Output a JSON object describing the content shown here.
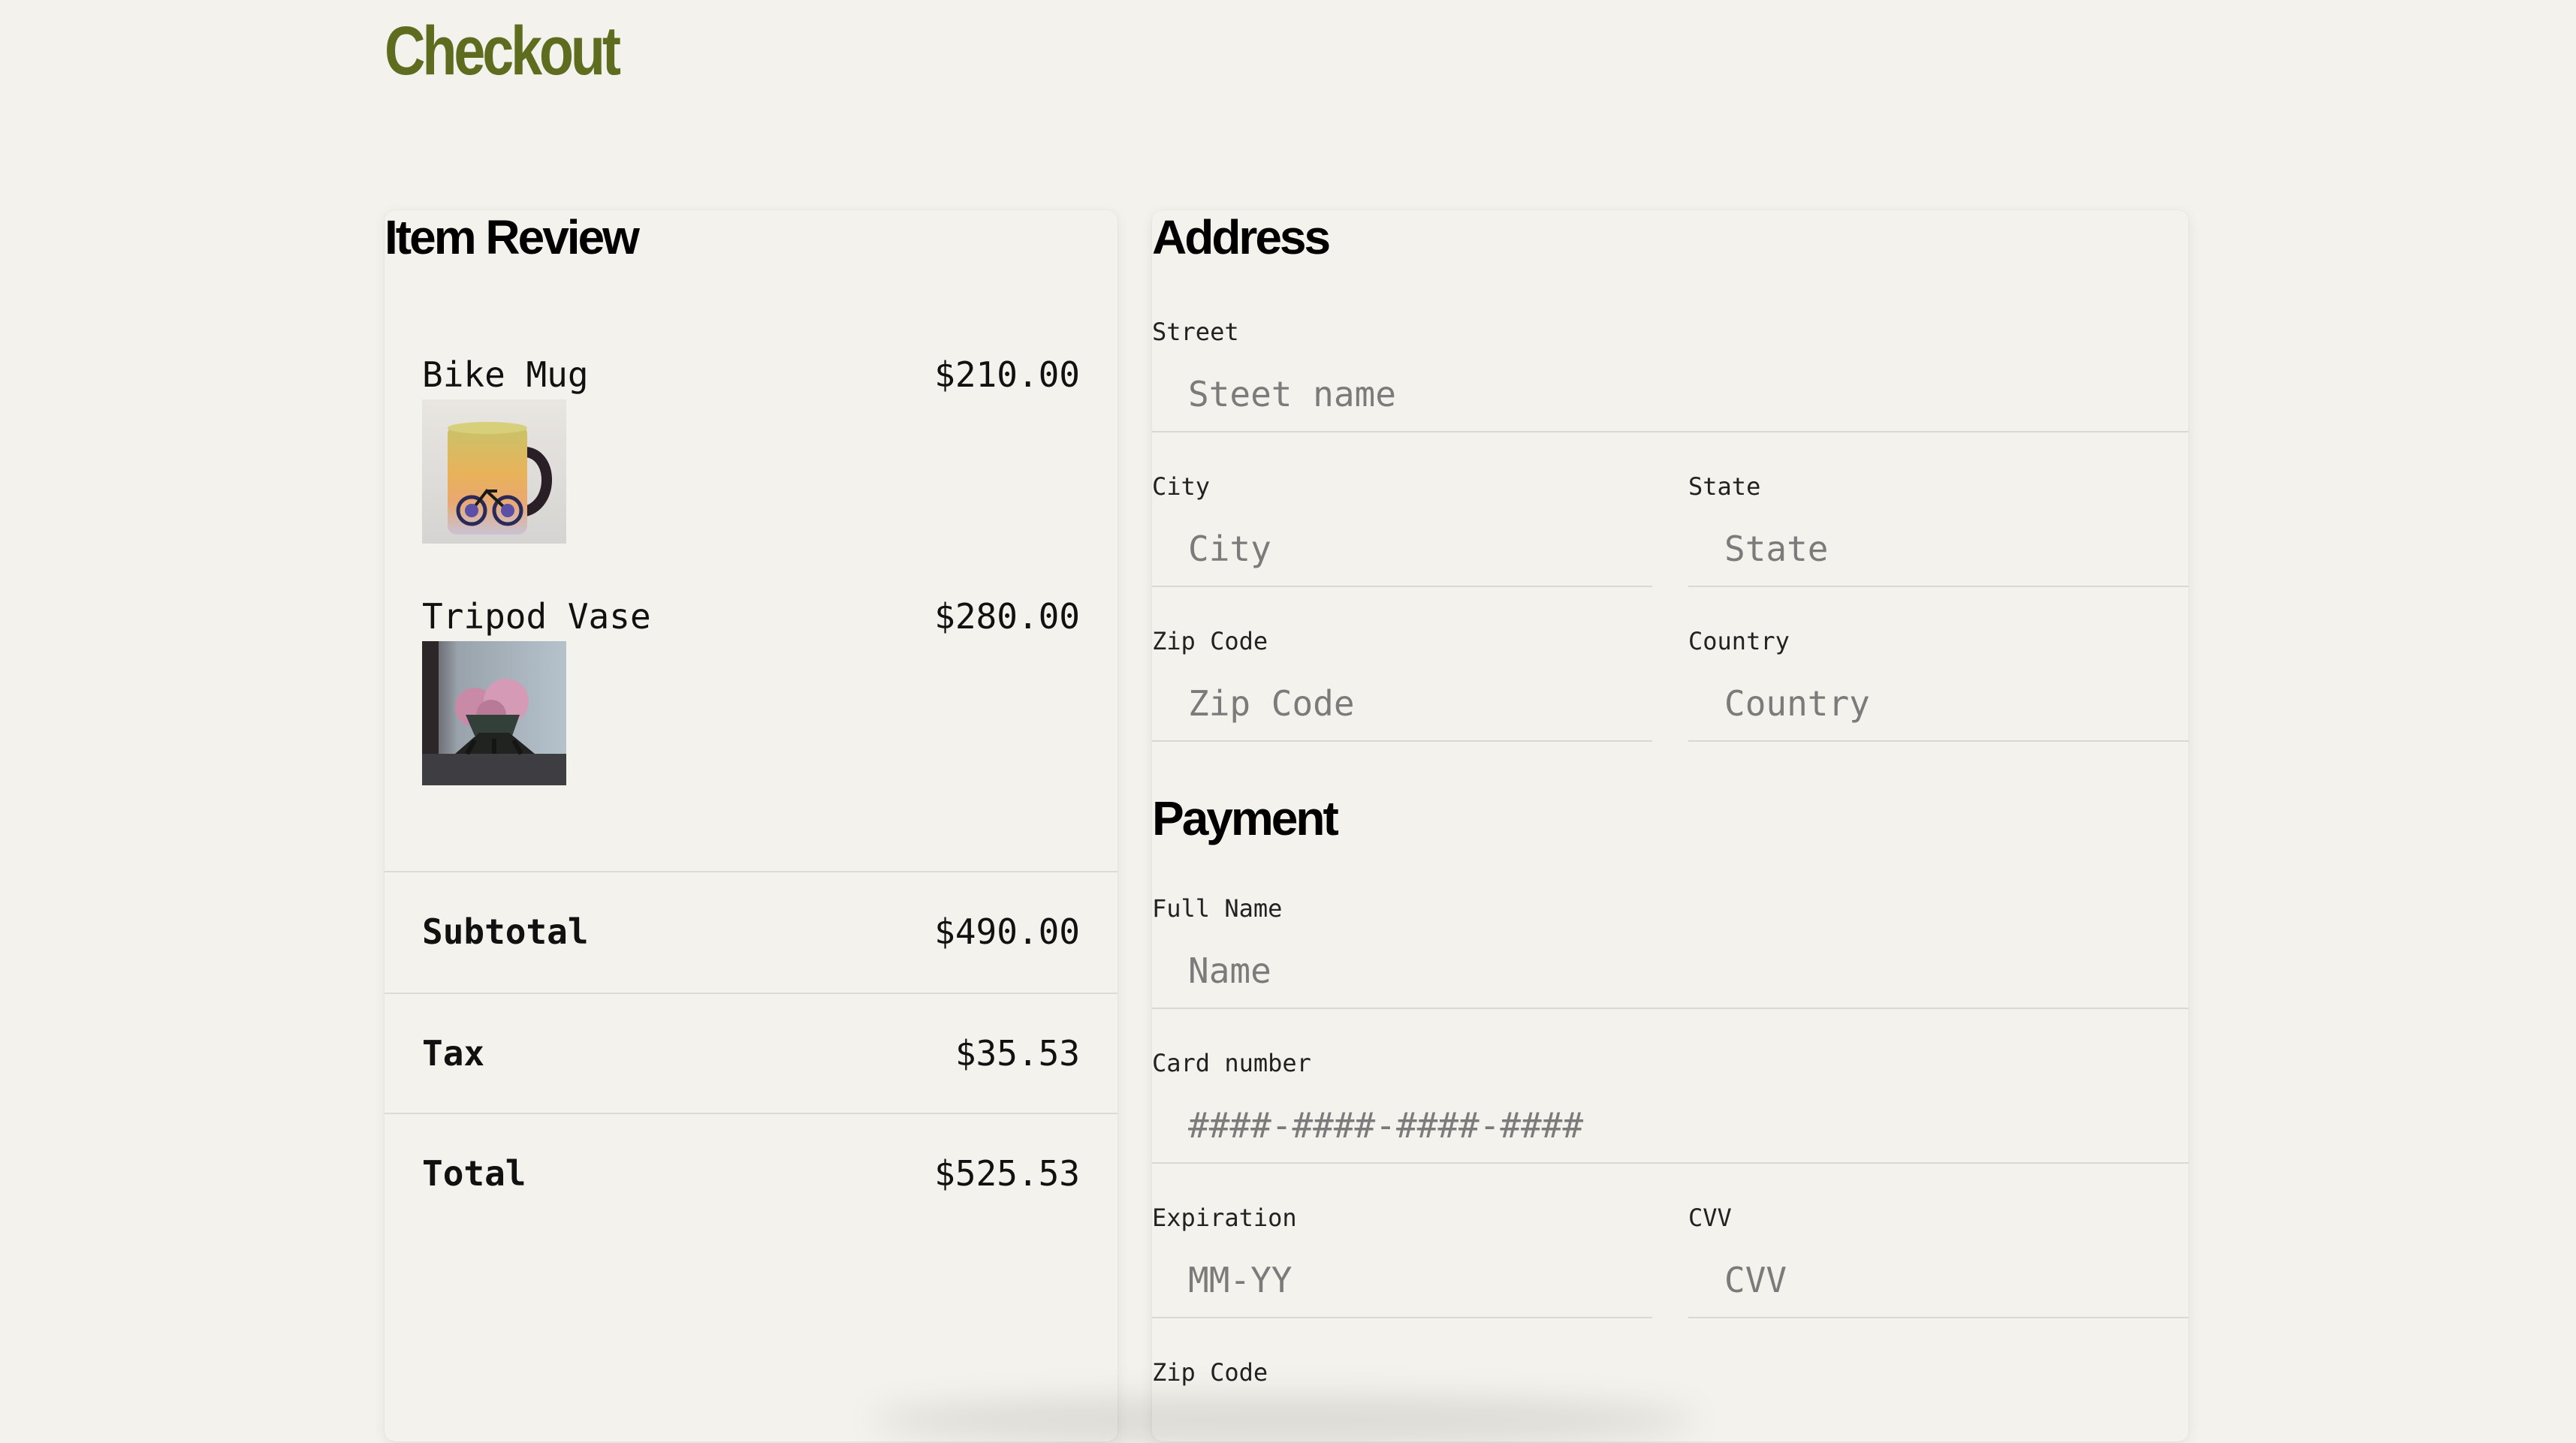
{
  "page": {
    "title": "Checkout"
  },
  "review": {
    "title": "Item Review",
    "items": [
      {
        "name": "Bike Mug",
        "price": "$210.00",
        "image": "mug-with-bicycle-illustration"
      },
      {
        "name": "Tripod Vase",
        "price": "$280.00",
        "image": "vase-with-pink-flowers"
      }
    ],
    "subtotal": {
      "label": "Subtotal",
      "value": "$490.00"
    },
    "tax": {
      "label": "Tax",
      "value": "$35.53"
    },
    "total": {
      "label": "Total",
      "value": "$525.53"
    }
  },
  "address": {
    "title": "Address",
    "street": {
      "label": "Street",
      "placeholder": "Steet name"
    },
    "city": {
      "label": "City",
      "placeholder": "City"
    },
    "state": {
      "label": "State",
      "placeholder": "State"
    },
    "zip": {
      "label": "Zip Code",
      "placeholder": "Zip Code"
    },
    "country": {
      "label": "Country",
      "placeholder": "Country"
    }
  },
  "payment": {
    "title": "Payment",
    "full_name": {
      "label": "Full Name",
      "placeholder": "Name"
    },
    "card_number": {
      "label": "Card number",
      "placeholder": "####-####-####-####"
    },
    "expiration": {
      "label": "Expiration",
      "placeholder": "MM-YY"
    },
    "cvv": {
      "label": "CVV",
      "placeholder": "CVV"
    },
    "zip": {
      "label": "Zip Code"
    }
  },
  "colors": {
    "background": "#f4f2ec",
    "title_accent": "#5d6c1f",
    "divider": "#dad7cf",
    "placeholder": "#7b7b7b"
  }
}
